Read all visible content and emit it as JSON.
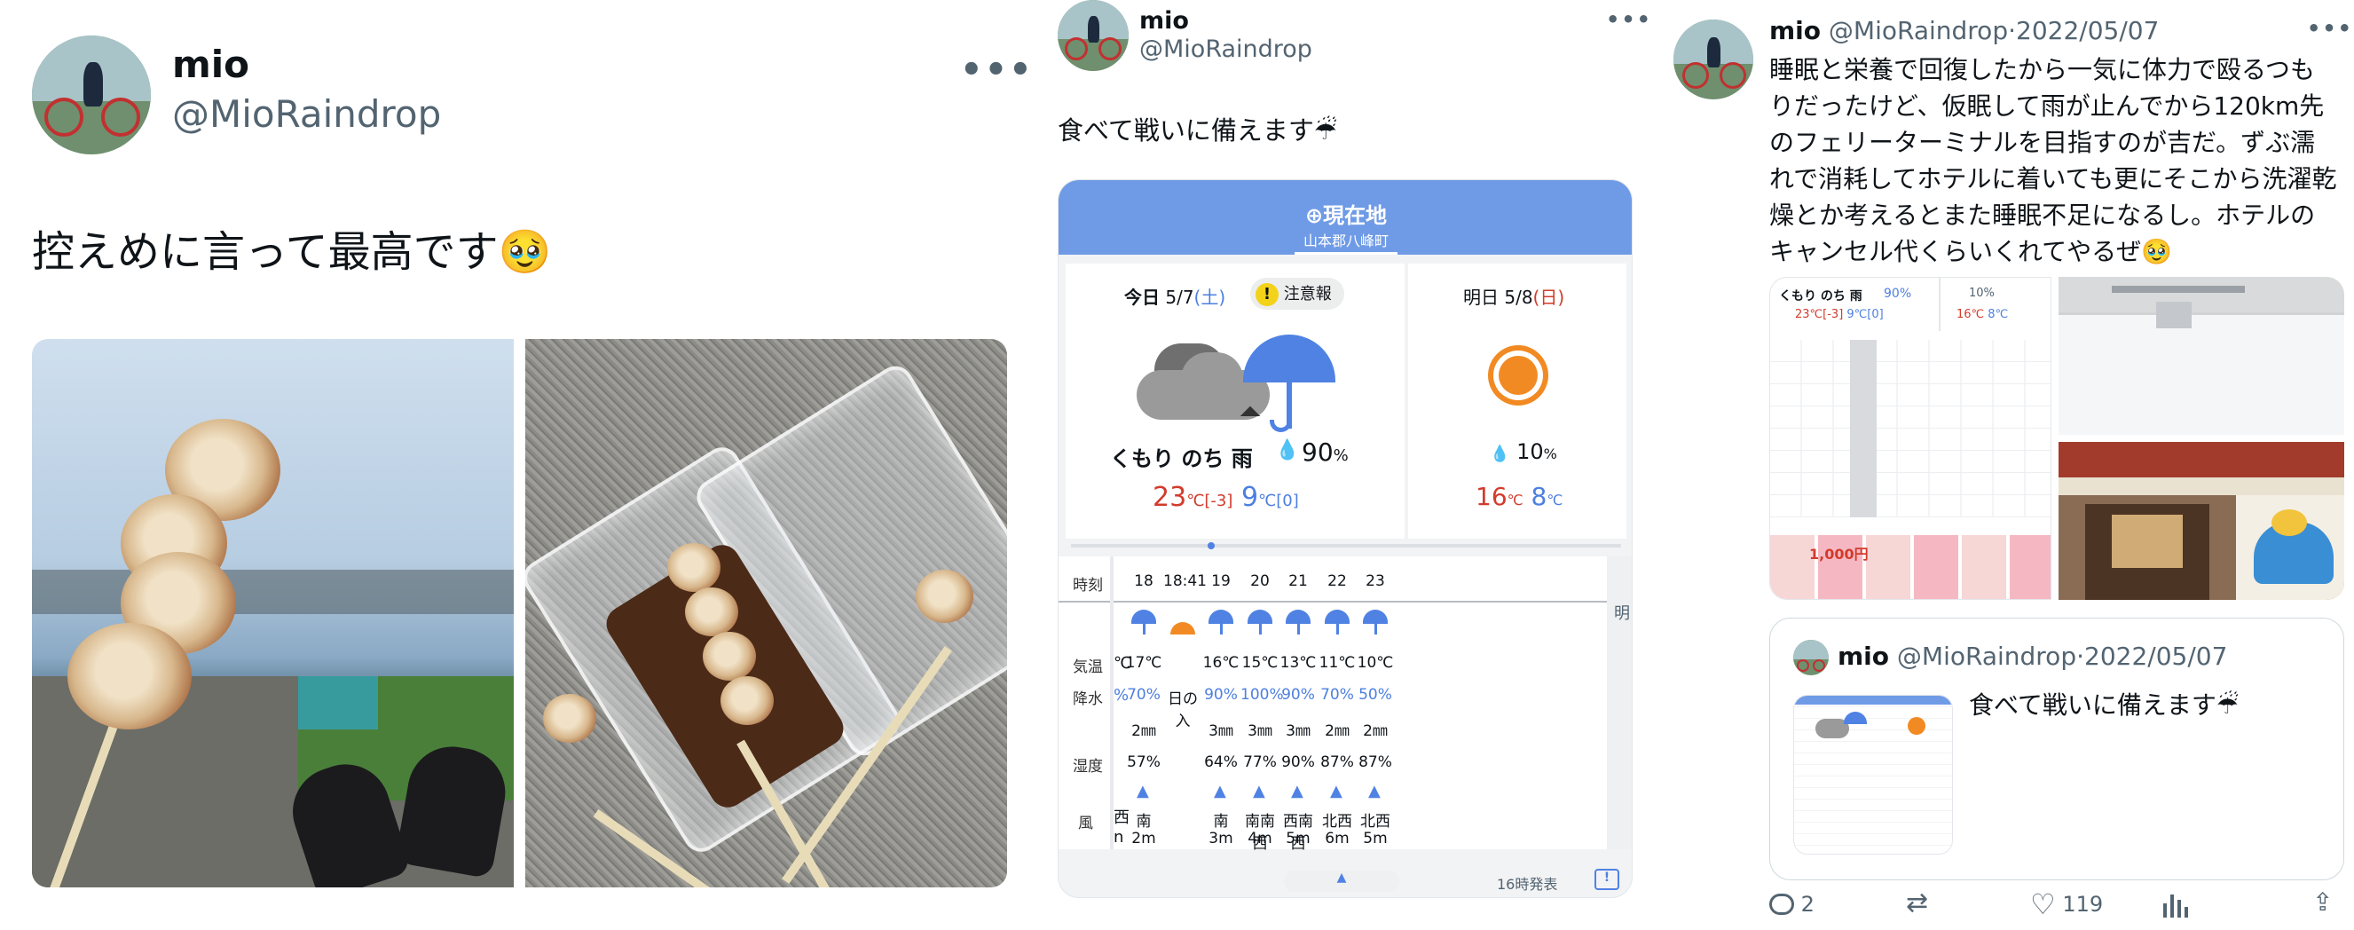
{
  "tweet1": {
    "name": "mio",
    "handle": "@MioRaindrop",
    "text": "控えめに言って最高です🥹"
  },
  "tweet2": {
    "name": "mio",
    "handle": "@MioRaindrop",
    "text": "食べて戦いに備えます☔",
    "weather": {
      "location_title": "⊕現在地",
      "location_sub": "山本郡八峰町",
      "today_label": "今日",
      "today_date": "5/7",
      "today_day": "(土)",
      "warning_icon": "!",
      "warning": "注意報",
      "today_cond": "くもり のち 雨",
      "today_pop": "90",
      "pop_unit": "%",
      "today_hi": "23",
      "today_hi_diff": "[-3]",
      "today_lo": "9",
      "today_lo_diff": "[0]",
      "deg": "℃",
      "tomorrow_label": "明日",
      "tomorrow_date": "5/8",
      "tomorrow_day": "(日)",
      "tomorrow_pop": "10",
      "tomorrow_hi": "16",
      "tomorrow_lo": "8",
      "row_labels": {
        "time": "時刻",
        "temp": "気温",
        "rain": "降水",
        "humid": "湿度",
        "wind": "風"
      },
      "hours": [
        "18",
        "18:41",
        "19",
        "20",
        "21",
        "22",
        "23"
      ],
      "temps": [
        "17℃",
        "",
        "16℃",
        "15℃",
        "13℃",
        "11℃",
        "10℃"
      ],
      "pops": [
        "70%",
        "日の入",
        "90%",
        "100%",
        "90%",
        "70%",
        "50%"
      ],
      "precip": [
        "2㎜",
        "",
        "3㎜",
        "3㎜",
        "3㎜",
        "2㎜",
        "2㎜"
      ],
      "humid": [
        "57%",
        "",
        "64%",
        "77%",
        "90%",
        "87%",
        "87%"
      ],
      "wind_dir": [
        "南",
        "",
        "南",
        "南南西",
        "西南西",
        "北西",
        "北西"
      ],
      "wind_spd": [
        "2m",
        "",
        "3m",
        "4m",
        "5m",
        "6m",
        "5m"
      ],
      "partial_left": {
        "temp": "℃",
        "pop": "%",
        "dir": "西",
        "spd": "n"
      },
      "next_day_partial": "明",
      "issued": "16時発表"
    }
  },
  "tweet3": {
    "name": "mio",
    "handle": "@MioRaindrop",
    "date": "2022/05/07",
    "separator": "·",
    "text": "睡眠と栄養で回復したから一気に体力で殴るつもりだったけど、仮眠して雨が止んでから120km先のフェリーターミナルを目指すのが吉だ。ずぶ濡れで消耗してホテルに着いても更にそこから洗濯乾燥とか考えるとまた睡眠不足になるし。ホテルのキャンセル代くらいくれてやるぜ🥹",
    "quote": {
      "name": "mio",
      "handle": "@MioRaindrop",
      "date": "2022/05/07",
      "text": "食べて戦いに備えます☔"
    },
    "thumb_weather": {
      "cond": "くもり のち 雨",
      "pop": "90%",
      "hi": "23℃",
      "hi_diff": "[-3]",
      "lo": "9℃",
      "lo_diff": "[0]",
      "tpop": "10%",
      "thi": "16℃",
      "tlo": "8℃",
      "ad": "1,000円"
    },
    "actions": {
      "replies": "2",
      "likes": "119"
    }
  },
  "colors": {
    "accent": "#6f9be6",
    "rain_blue": "#4d7fe0",
    "hot_red": "#d23b2b",
    "text": "#0f1419",
    "muted": "#536471"
  }
}
